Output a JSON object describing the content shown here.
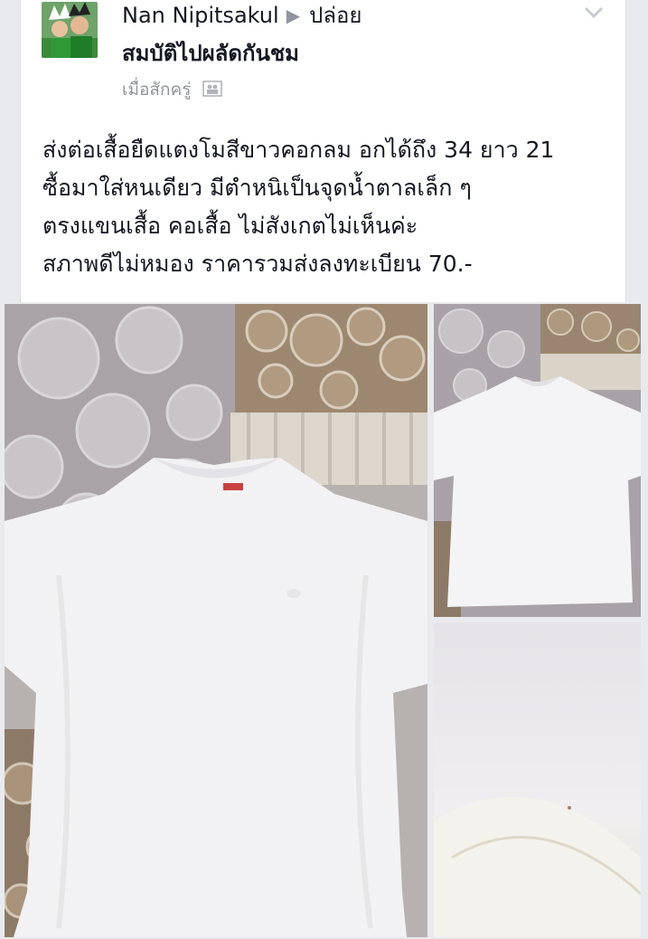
{
  "post": {
    "author": "Nan Nipitsakul",
    "arrow_icon": "right-triangle-icon",
    "group": "ปล่อย",
    "group_line2": "สมบัติไปผลัดกันชม",
    "time": "เมื่อสักครู่",
    "privacy_icon": "friends-icon",
    "options_icon": "chevron-down-icon",
    "text_lines": [
      "ส่งต่อเสื้อยืดแตงโมสีขาวคอกลม อกได้ถึง 34 ยาว 21",
      "ซื้อมาใส่หนเดียว มีตำหนิเป็นจุดน้ำตาลเล็ก ๆ",
      "ตรงแขนเสื้อ คอเสื้อ ไม่สังเกตไม่เห็นค่ะ",
      "สภาพดีไม่หมอง ราคารวมส่งลงทะเบียน 70.-"
    ]
  },
  "colors": {
    "page_bg": "#e9eaed",
    "text": "#141823",
    "meta": "#90949c"
  }
}
